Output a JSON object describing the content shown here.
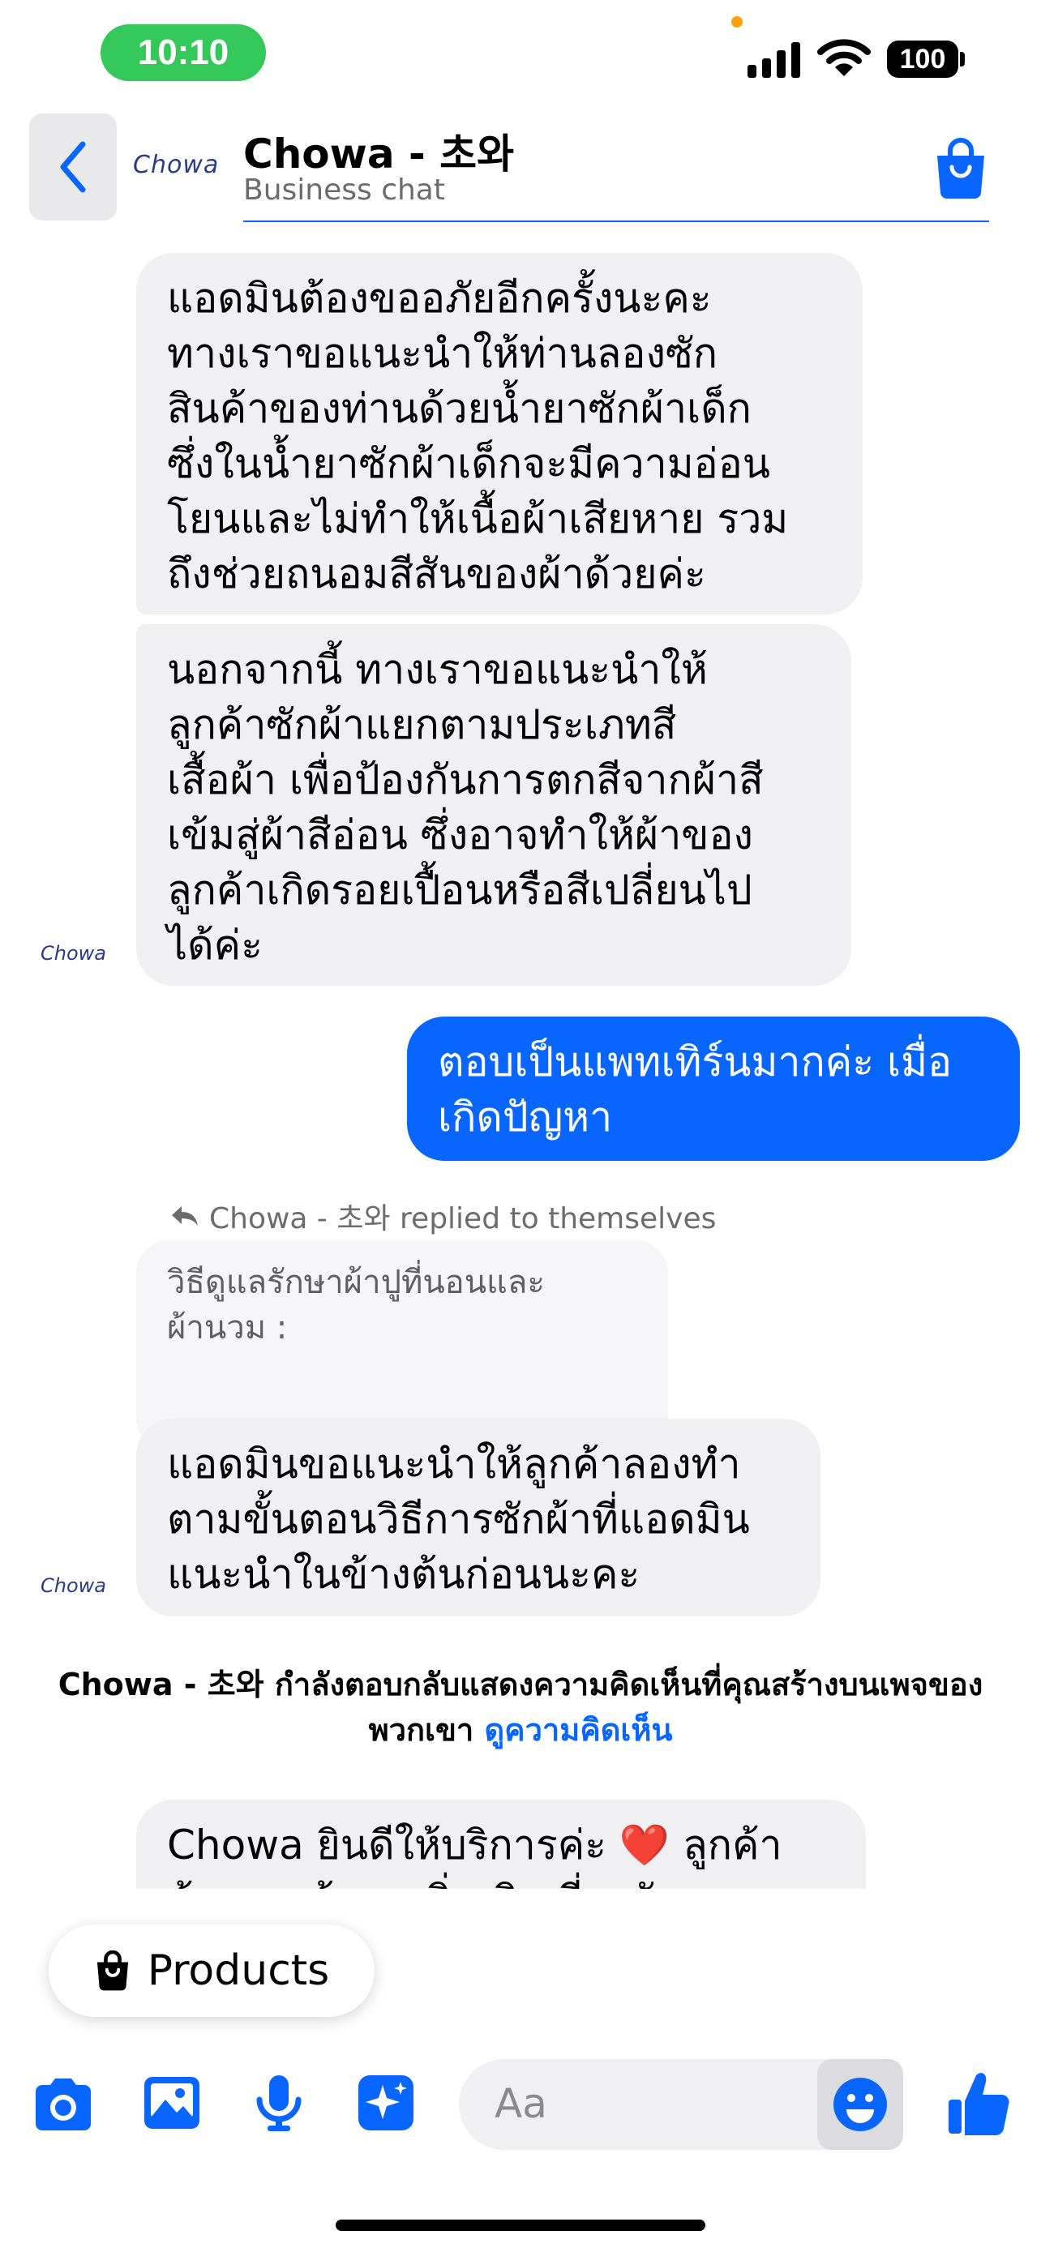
{
  "status_bar": {
    "time": "10:10",
    "battery": "100"
  },
  "header": {
    "brand_logo": "Chowa",
    "title": "Chowa - 초와",
    "subtitle": "Business chat"
  },
  "messages": {
    "m1": "แอดมินต้องขออภัยอีกครั้งนะคะ\nทางเราขอแนะนำให้ท่านลองซัก\nสินค้าของท่านด้วยน้ำยาซักผ้าเด็ก\nซึ่งในน้ำยาซักผ้าเด็กจะมีความอ่อน\nโยนและไม่ทำให้เนื้อผ้าเสียหาย รวม\nถึงช่วยถนอมสีสันของผ้าด้วยค่ะ",
    "m2": "นอกจากนี้ ทางเราขอแนะนำให้\nลูกค้าซักผ้าแยกตามประเภทสี\nเสื้อผ้า เพื่อป้องกันการตกสีจากผ้าสี\nเข้มสู่ผ้าสีอ่อน ซึ่งอาจทำให้ผ้าของ\nลูกค้าเกิดรอยเปื้อนหรือสีเปลี่ยนไป\nได้ค่ะ",
    "m3": "ตอบเป็นแพทเทิร์นมากค่ะ เมื่อ\nเกิดปัญหา",
    "reply_note": "Chowa - 초와 replied to themselves",
    "quoted": "วิธีดูแลรักษาผ้าปูที่นอนและ\nผ้านวม :",
    "m4": "แอดมินขอแนะนำให้ลูกค้าลองทำ\nตามขั้นตอนวิธีการซักผ้าที่แอดมิน\nแนะนำในข้างต้นก่อนนะคะ",
    "m5_line1": "Chowa ยินดีให้บริการค่ะ ❤️ ลูกค้า",
    "m5_line2": "ต้องการข้อมูลเพิ่มเติมเกี่ยวกับ",
    "avatar_label": "Chowa"
  },
  "notice": {
    "text": "Chowa - 초와 กำลังตอบกลับแสดงความคิดเห็นที่คุณสร้างบนเพจของพวกเขา ",
    "link": "ดูความคิดเห็น"
  },
  "products_button": {
    "label": "Products"
  },
  "composer": {
    "placeholder": "Aa"
  },
  "colors": {
    "accent": "#0866ff",
    "bubble_in": "#f0f0f2",
    "time_pill": "#34c759"
  }
}
